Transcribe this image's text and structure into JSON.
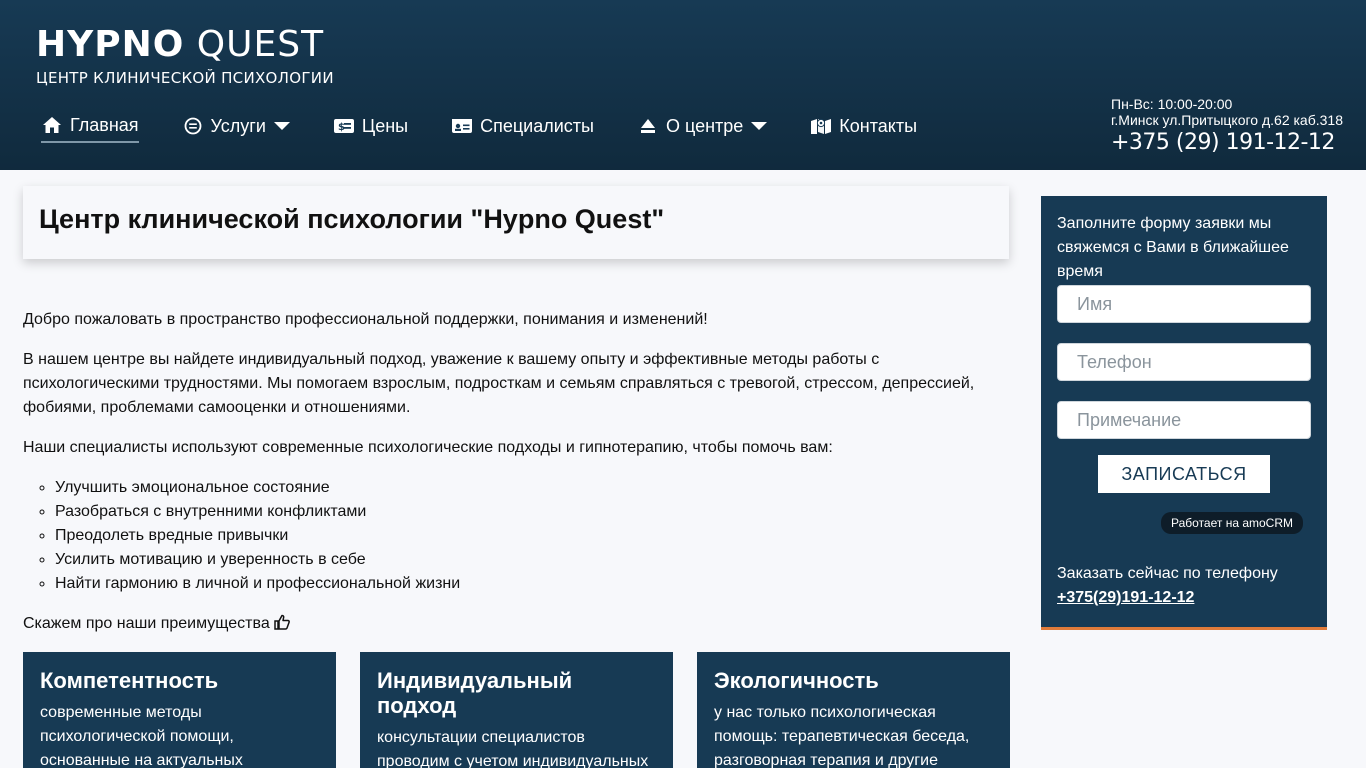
{
  "header": {
    "logo_bold": "HYPNO",
    "logo_light": "QUEST",
    "logo_sub": "ЦЕНТР КЛИНИЧЕСКОЙ ПСИХОЛОГИИ",
    "nav": [
      {
        "label": "Главная",
        "icon": "home-icon"
      },
      {
        "label": "Услуги",
        "icon": "minus-circle-icon"
      },
      {
        "label": "Цены",
        "icon": "money-icon"
      },
      {
        "label": "Специалисты",
        "icon": "id-card-icon"
      },
      {
        "label": "О центре",
        "icon": "eject-icon"
      },
      {
        "label": "Контакты",
        "icon": "map-icon"
      }
    ],
    "hours": "Пн-Вс: 10:00-20:00",
    "address": "г.Минск ул.Притыцкого д.62 каб.318",
    "phone": "+375 (29) 191-12-12"
  },
  "main": {
    "title": "Центр клинической психологии \"Hypno Quest\"",
    "paragraphs": [
      "Добро пожаловать в пространство профессиональной поддержки, понимания и изменений!",
      "В нашем центре вы найдете индивидуальный подход, уважение к вашему опыту и эффективные методы работы с психологическими трудностями. Мы помогаем взрослым, подросткам и семьям справляться с тревогой, стрессом, депрессией, фобиями, проблемами самооценки и отношениями.",
      "Наши специалисты используют современные психологические подходы и гипнотерапию, чтобы помочь вам:"
    ],
    "list": [
      "Улучшить эмоциональное состояние",
      "Разобраться с внутренними конфликтами",
      "Преодолеть вредные привычки",
      "Усилить мотивацию и уверенность в себе",
      "Найти гармонию в личной и профессиональной жизни"
    ],
    "advantages_intro": "Скажем про наши преимущества",
    "cards": [
      {
        "title": "Компетентность",
        "text": "современные методы психологической помощи, основанные на актуальных"
      },
      {
        "title": "Индивидуальный подход",
        "text": "консультации специалистов проводим с учетом индивидуальных"
      },
      {
        "title": "Экологичность",
        "text": "у нас только психологическая помощь: терапевтическая беседа, разговорная терапия и другие"
      }
    ]
  },
  "form": {
    "intro": "Заполните форму заявки мы свяжемся с Вами в ближайшее время",
    "name_placeholder": "Имя",
    "phone_placeholder": "Телефон",
    "note_placeholder": "Примечание",
    "submit_label": "ЗАПИСАТЬСЯ",
    "powered": "Работает на amoCRM",
    "order_text": "Заказать сейчас по телефону",
    "order_phone": "+375(29)191-12-12"
  },
  "colors": {
    "header_bg": "#173a54",
    "card_bg": "#173a54",
    "form_accent": "#e07b3a"
  }
}
